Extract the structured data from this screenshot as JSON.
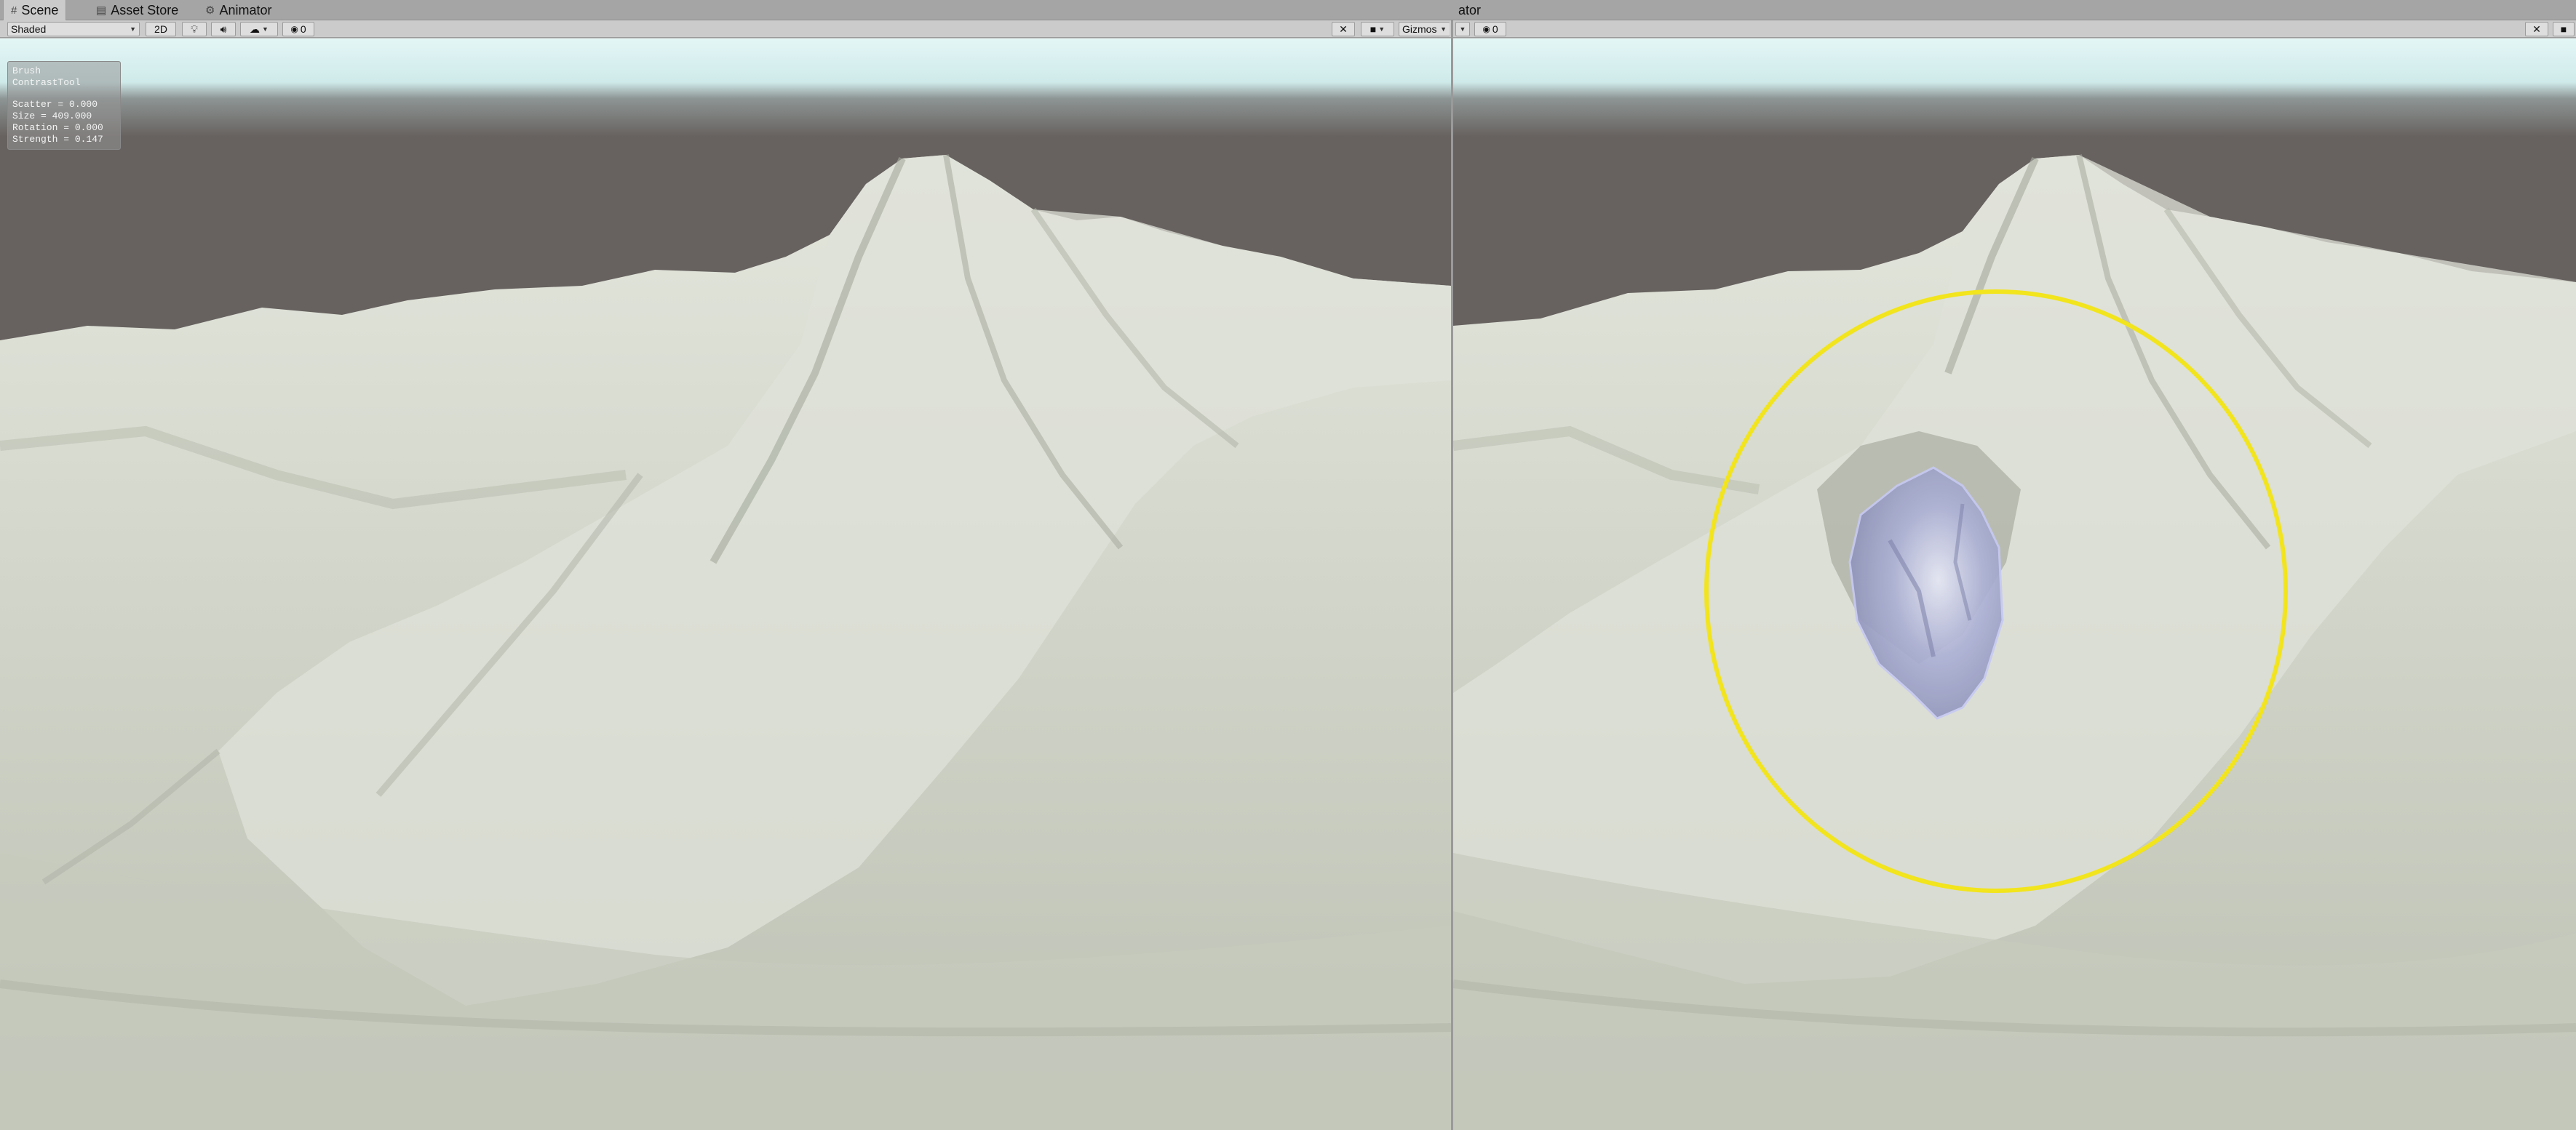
{
  "left_pane": {
    "tabs": [
      {
        "label": "Scene",
        "icon": "scene-grid-icon",
        "active": true
      },
      {
        "label": "Asset Store",
        "icon": "asset-store-icon",
        "active": false
      },
      {
        "label": "Animator",
        "icon": "animator-icon",
        "active": false
      }
    ],
    "toolbar": {
      "shading_mode": "Shaded",
      "mode_2d": "2D",
      "hidden_count": "0"
    }
  },
  "right_pane": {
    "tab_partial": "ator",
    "toolbar": {
      "gizmos_label": "Gizmos",
      "hidden_count": "0"
    }
  },
  "overlay": {
    "line1": "Brush",
    "line2": "ContrastTool",
    "scatter": "Scatter = 0.000",
    "size": "Size = 409.000",
    "rotation": "Rotation = 0.000",
    "strength": "Strength = 0.147"
  },
  "colors": {
    "sky_top": "#cdebeb",
    "sky_band": "#676260",
    "terrain": "#d3d7cc",
    "terrain_shadow": "#a8ad9f",
    "brush_circle": "#f2e41d",
    "brush_blob": "#a8acd8"
  }
}
